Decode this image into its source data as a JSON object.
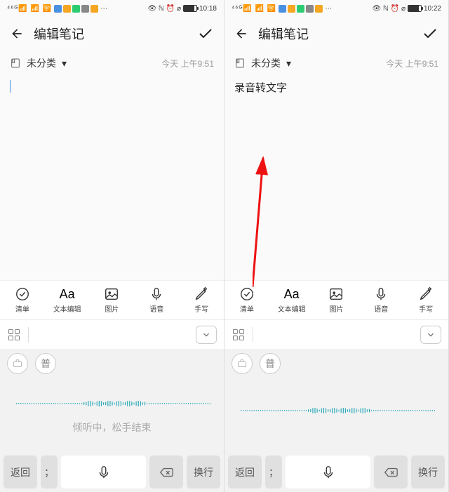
{
  "left": {
    "status": {
      "time": "10:18",
      "dots": "⋯"
    },
    "header": {
      "title": "编辑笔记"
    },
    "category": {
      "label": "未分类",
      "timestamp": "今天 上午9:51"
    },
    "content": "",
    "toolbar": [
      {
        "label": "清单",
        "icon": "check-circle"
      },
      {
        "label": "文本编辑",
        "icon": "text-aa"
      },
      {
        "label": "图片",
        "icon": "image"
      },
      {
        "label": "语音",
        "icon": "mic"
      },
      {
        "label": "手写",
        "icon": "pen"
      }
    ],
    "modes": {
      "briefcase": "",
      "pu": "普"
    },
    "listening": "倾听中，松手结束",
    "keys": {
      "back": "返回",
      "semicolon": "；",
      "enter": "换行"
    }
  },
  "right": {
    "status": {
      "time": "10:22",
      "dots": "⋯"
    },
    "header": {
      "title": "编辑笔记"
    },
    "category": {
      "label": "未分类",
      "timestamp": "今天 上午9:51"
    },
    "content": "录音转文字",
    "toolbar": [
      {
        "label": "清单",
        "icon": "check-circle"
      },
      {
        "label": "文本编辑",
        "icon": "text-aa"
      },
      {
        "label": "图片",
        "icon": "image"
      },
      {
        "label": "语音",
        "icon": "mic"
      },
      {
        "label": "手写",
        "icon": "pen"
      }
    ],
    "modes": {
      "briefcase": "",
      "pu": "普"
    },
    "listening": "",
    "keys": {
      "back": "返回",
      "semicolon": "；",
      "enter": "换行"
    }
  }
}
